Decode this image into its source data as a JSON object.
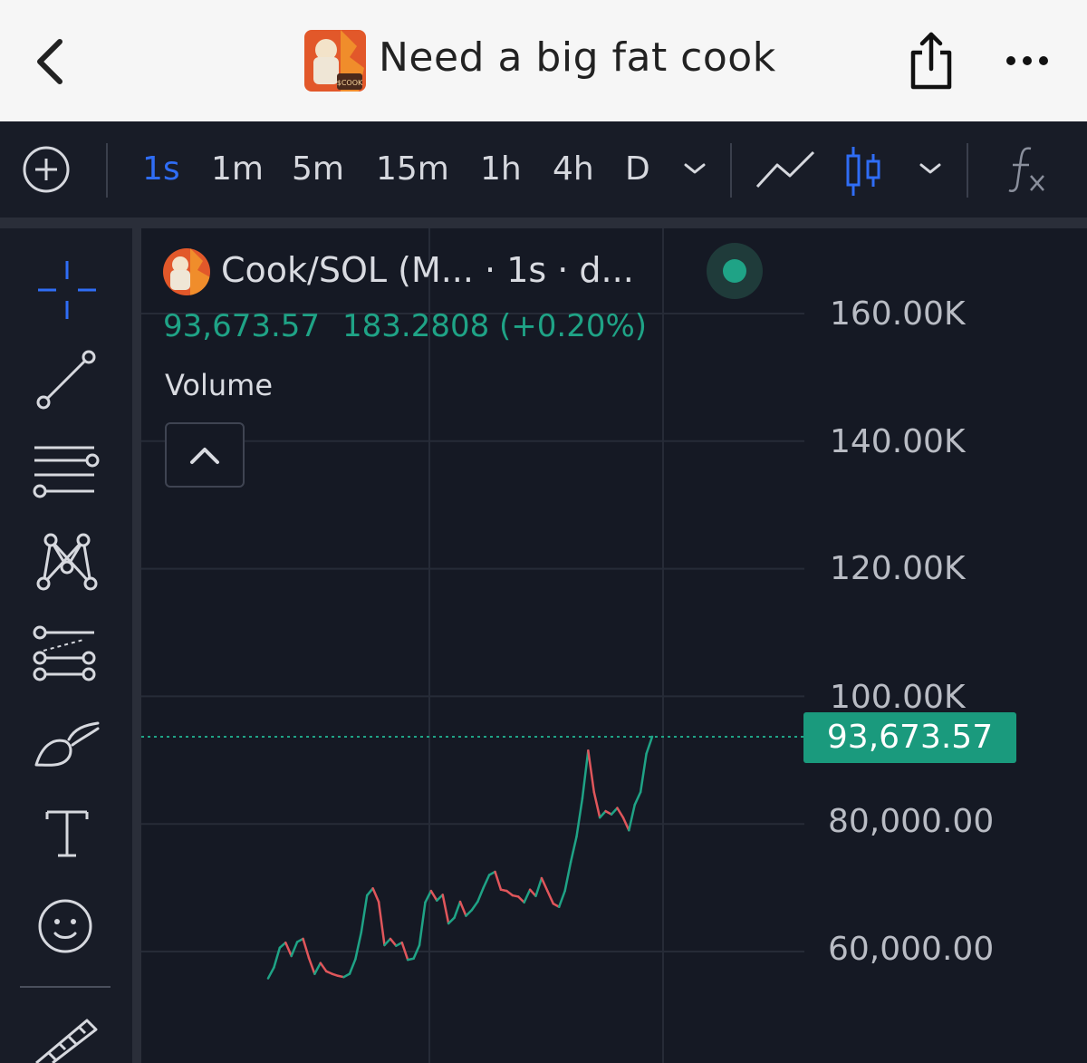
{
  "header": {
    "title": "Need a big fat cook",
    "avatar_label": "$COOK"
  },
  "toolbar": {
    "timeframes": [
      "1s",
      "1m",
      "5m",
      "15m",
      "1h",
      "4h",
      "D"
    ],
    "active_timeframe": "1s",
    "icons": [
      "add-chart-icon",
      "chevron-down-icon",
      "line-chart-icon",
      "candles-icon",
      "chevron-down-icon",
      "indicators-fx-icon"
    ]
  },
  "sidebar": {
    "tools": [
      "crosshair-icon",
      "trend-line-icon",
      "horizontal-lines-icon",
      "pattern-icon",
      "fib-icon",
      "brush-icon",
      "text-icon",
      "emoji-icon",
      "ruler-icon"
    ]
  },
  "legend": {
    "title": "Cook/SOL (M... · 1s · d...",
    "price": "93,673.57",
    "change": "183.2808 (+0.20%)",
    "volume_label": "Volume"
  },
  "price_tag": "93,673.57",
  "colors": {
    "up": "#1fa386",
    "down": "#e0565b",
    "accent": "#2f6df5"
  },
  "chart_data": {
    "type": "line",
    "title": "",
    "xlabel": "",
    "ylabel": "",
    "y_ticks": [
      "160.00K",
      "140.00K",
      "120.00K",
      "100.00K",
      "80,000.00",
      "60,000.00"
    ],
    "ylim": [
      40000,
      165000
    ],
    "last_price": 93673.57,
    "series": [
      {
        "values": [
          55800,
          57500,
          60600,
          61400,
          59300,
          61500,
          62000,
          59000,
          56500,
          58200,
          56900,
          56500,
          56200,
          56000,
          56500,
          58800,
          63000,
          68800,
          69900,
          67800,
          61000,
          62000,
          60900,
          61400,
          58700,
          58900,
          61000,
          67700,
          69500,
          68000,
          68900,
          64400,
          65300,
          67800,
          65600,
          66500,
          67800,
          70000,
          72000,
          72500,
          69700,
          69500,
          68800,
          68600,
          67700,
          69700,
          68700,
          71500,
          69500,
          67500,
          67000,
          69500,
          74000,
          78000,
          84000,
          91500,
          85000,
          81000,
          82000,
          81500,
          82500,
          81000,
          79000,
          83000,
          85000,
          91000,
          93673.57
        ]
      }
    ]
  }
}
